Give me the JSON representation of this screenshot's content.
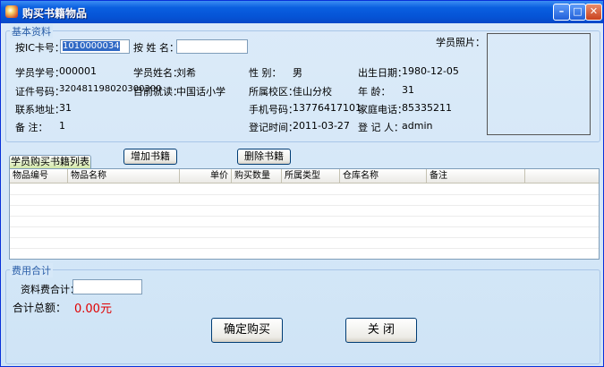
{
  "window": {
    "title": "购买书籍物品"
  },
  "basic_info": {
    "section_title": "基本资料",
    "search_by_card_label": "按IC卡号：",
    "search_by_card_value": "1010000034",
    "search_by_name_label": "按 姓 名：",
    "search_by_name_value": "",
    "photo_label": "学员照片：",
    "fields": {
      "student_no_label": "学员学号：",
      "student_no": "000001",
      "student_name_label": "学员姓名：",
      "student_name": "刘希",
      "gender_label": "性    别：",
      "gender": "男",
      "birth_label": "出生日期：",
      "birth": "1980-12-05",
      "id_no_label": "证件号码：",
      "id_no": "320481198020300300",
      "current_school_label": "目前就读：",
      "current_school": "中国话小学",
      "campus_label": "所属校区：",
      "campus": "佳山分校",
      "age_label": "年    龄：",
      "age": "31",
      "address_label": "联系地址：",
      "address": "31",
      "mobile_label": "手机号码：",
      "mobile": "13776417101",
      "phone_label": "家庭电话：",
      "phone": "85335211",
      "note_label": "备    注：",
      "note": "1",
      "reg_time_label": "登记时间：",
      "reg_time": "2011-03-27",
      "registrar_label": "登 记 人：",
      "registrar": "admin"
    }
  },
  "actions": {
    "add_book": "增加书籍",
    "delete_book": "删除书籍"
  },
  "book_list": {
    "tab_label": "学员购买书籍列表",
    "columns": [
      "物品编号",
      "物品名称",
      "单价",
      "购买数量",
      "所属类型",
      "仓库名称",
      "备注"
    ],
    "rows": []
  },
  "fees": {
    "section_title": "费用合计",
    "material_fee_label": "资料费合计：",
    "material_fee_value": "",
    "total_label": "合计总额：",
    "total_value": "0.00元"
  },
  "buttons": {
    "confirm": "确定购买",
    "close": "关  闭"
  }
}
